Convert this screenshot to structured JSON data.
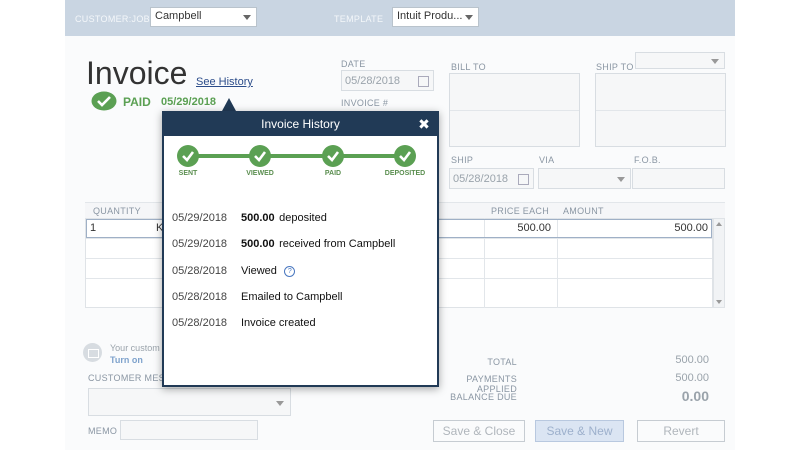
{
  "topbar": {
    "customer_job_label": "CUSTOMER:JOB",
    "customer_job_value": "Campbell",
    "template_label": "TEMPLATE",
    "template_value": "Intuit Produ..."
  },
  "invoice": {
    "title": "Invoice",
    "see_history": "See History",
    "paid_label": "PAID",
    "paid_date": "05/29/2018"
  },
  "header_fields": {
    "date_label": "DATE",
    "date_value": "05/28/2018",
    "invoice_no_label": "INVOICE #",
    "bill_to_label": "BILL TO",
    "ship_to_label": "SHIP TO",
    "ship_label": "SHIP",
    "ship_value": "05/28/2018",
    "via_label": "VIA",
    "fob_label": "F.O.B."
  },
  "table": {
    "col_quantity": "QUANTITY",
    "col_price_each": "PRICE EACH",
    "col_amount": "AMOUNT",
    "row1_quantity": "1",
    "row1_item_fragment": "K",
    "row1_price": "500.00",
    "row1_amount": "500.00"
  },
  "footer": {
    "customer_notice": "Your custom",
    "turn_on": "Turn on",
    "customer_message_label": "CUSTOMER MESS",
    "memo_label": "MEMO",
    "total_label": "TOTAL",
    "total_value": "500.00",
    "payments_label": "PAYMENTS APPLIED",
    "payments_value": "500.00",
    "balance_label": "BALANCE DUE",
    "balance_value": "0.00"
  },
  "buttons": {
    "save_close": "Save & Close",
    "save_new": "Save & New",
    "revert": "Revert"
  },
  "popup": {
    "title": "Invoice History",
    "close": "✖",
    "steps": [
      "SENT",
      "VIEWED",
      "PAID",
      "DEPOSITED"
    ],
    "history": [
      {
        "date": "05/29/2018",
        "amount": "500.00",
        "text": "deposited"
      },
      {
        "date": "05/29/2018",
        "amount": "500.00",
        "text": "received from Campbell"
      },
      {
        "date": "05/28/2018",
        "amount": "",
        "text": "Viewed"
      },
      {
        "date": "05/28/2018",
        "amount": "",
        "text": "Emailed to Campbell"
      },
      {
        "date": "05/28/2018",
        "amount": "",
        "text": "Invoice created"
      }
    ]
  },
  "colors": {
    "paid_green": "#5ba053",
    "popup_navy": "#213a56",
    "link_blue": "#2b4c8a"
  }
}
